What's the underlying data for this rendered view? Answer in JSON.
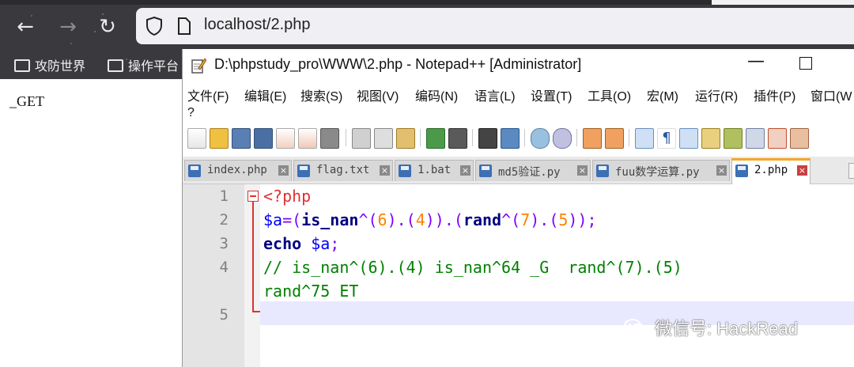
{
  "browser": {
    "url": "localhost/2.php",
    "bookmarks": [
      "攻防世界",
      "操作平台"
    ],
    "page_output": "_GET"
  },
  "notepad": {
    "title": "D:\\phpstudy_pro\\WWW\\2.php - Notepad++ [Administrator]",
    "menu": [
      "文件(F)",
      "编辑(E)",
      "搜索(S)",
      "视图(V)",
      "编码(N)",
      "语言(L)",
      "设置(T)",
      "工具(O)",
      "宏(M)",
      "运行(R)",
      "插件(P)",
      "窗口(W"
    ],
    "menu_extra": "?",
    "tabs": [
      "index.php",
      "flag.txt",
      "1.bat",
      "md5验证.py",
      "fuu数学运算.py",
      "2.php"
    ],
    "active_tab": "2.php",
    "line_numbers": [
      "1",
      "2",
      "3",
      "4",
      "5"
    ],
    "code": {
      "line1": "<?php",
      "line2": {
        "var": "$a",
        "eq": "=(",
        "fn1": "is_nan",
        "op1": "^(",
        "n1": "6",
        "op2": ").(",
        "n2": "4",
        "op3": ")).(",
        "fn2": "rand",
        "op4": "^(",
        "n3": "7",
        "op5": ").(",
        "n4": "5",
        "op6": "));"
      },
      "line3": {
        "kw": "echo",
        "var": " $a",
        "end": ";"
      },
      "line4_comment": "// is_nan^(6).(4) is_nan^64 _G  rand^(7).(5)",
      "line4_wrap": "rand^75 ET"
    }
  },
  "watermark": "微信号: HackRead"
}
